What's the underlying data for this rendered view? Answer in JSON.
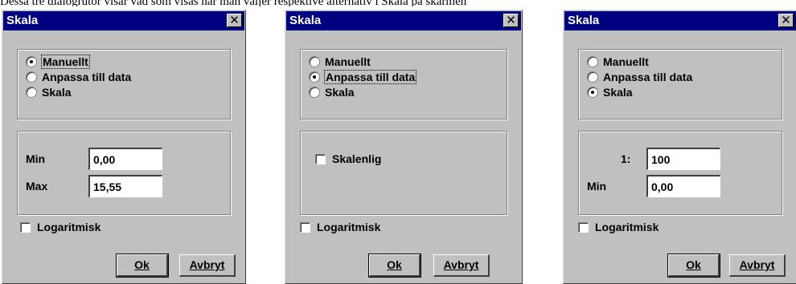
{
  "caption": "Dessa tre dialogrutor visar vad som visas när man väljer respektive alternativ i Skala på skärmen",
  "dialogs": [
    {
      "title": "Skala",
      "options": [
        "Manuellt",
        "Anpassa till data",
        "Skala"
      ],
      "selected": "Manuellt",
      "fields": [
        {
          "label": "Min",
          "value": "0,00"
        },
        {
          "label": "Max",
          "value": "15,55"
        }
      ],
      "logaritmisk_label": "Logaritmisk",
      "logaritmisk_checked": false,
      "ok_label": "Ok",
      "cancel_label": "Avbryt"
    },
    {
      "title": "Skala",
      "options": [
        "Manuellt",
        "Anpassa till data",
        "Skala"
      ],
      "selected": "Anpassa till data",
      "skalenlig_label": "Skalenlig",
      "skalenlig_checked": false,
      "logaritmisk_label": "Logaritmisk",
      "logaritmisk_checked": false,
      "ok_label": "Ok",
      "cancel_label": "Avbryt"
    },
    {
      "title": "Skala",
      "options": [
        "Manuellt",
        "Anpassa till data",
        "Skala"
      ],
      "selected": "Skala",
      "fields": [
        {
          "label": "1:",
          "value": "100"
        },
        {
          "label": "Min",
          "value": "0,00"
        }
      ],
      "logaritmisk_label": "Logaritmisk",
      "logaritmisk_checked": false,
      "ok_label": "Ok",
      "cancel_label": "Avbryt"
    }
  ],
  "icons": {
    "close": "close-icon"
  },
  "colors": {
    "titlebar": "#000080",
    "dialog_bg": "#c0c0c0"
  }
}
